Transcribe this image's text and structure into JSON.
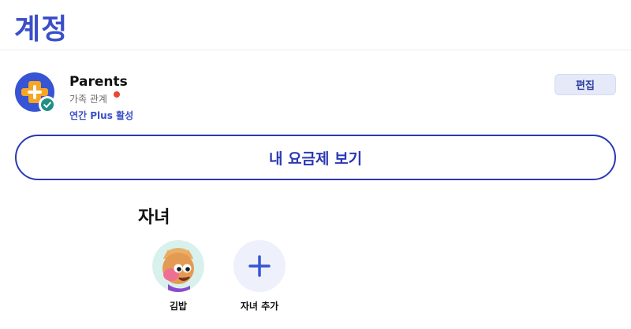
{
  "header": {
    "title": "계정"
  },
  "account": {
    "name": "Parents",
    "relation": "가족 관계",
    "plan_status": "연간 Plus 활성",
    "edit_label": "편집",
    "avatar_icon": "plus-badge-icon",
    "verified_icon": "checkmark-icon"
  },
  "plan_button": {
    "label": "내 요금제 보기"
  },
  "children": {
    "title": "자녀",
    "items": [
      {
        "name": "김밥",
        "avatar_icon": "cartoon-character-avatar"
      }
    ],
    "add_label": "자녀 추가",
    "add_icon": "plus-icon"
  },
  "colors": {
    "accent": "#3a4fc8",
    "primary_border": "#2a39b4",
    "avatar_bg": "#3654d4",
    "badge_orange": "#f5a623",
    "alert_dot": "#e8482f",
    "edit_bg": "#e6e9f8",
    "add_bg": "#eef1fb"
  }
}
